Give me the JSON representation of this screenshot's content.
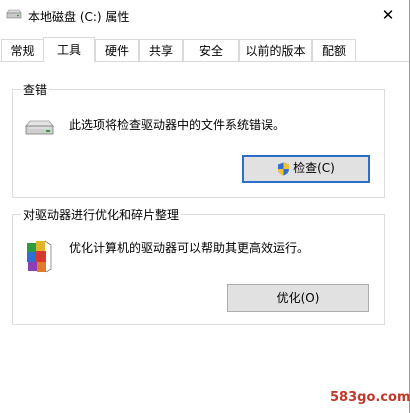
{
  "window": {
    "title": "本地磁盘 (C:) 属性",
    "close_glyph": "✕"
  },
  "tabs": [
    {
      "label": "常规",
      "active": false
    },
    {
      "label": "工具",
      "active": true
    },
    {
      "label": "硬件",
      "active": false
    },
    {
      "label": "共享",
      "active": false
    },
    {
      "label": "安全",
      "active": false
    },
    {
      "label": "以前的版本",
      "active": false
    },
    {
      "label": "配额",
      "active": false
    }
  ],
  "error_check": {
    "group_title": "查错",
    "description": "此选项将检查驱动器中的文件系统错误。",
    "button_label": "检查(C)",
    "icon": "drive-icon",
    "button_icon": "uac-shield-icon"
  },
  "optimize": {
    "group_title": "对驱动器进行优化和碎片整理",
    "description": "优化计算机的驱动器可以帮助其更高效运行。",
    "button_label": "优化(O)",
    "icon": "defrag-icon"
  },
  "watermark": "583go.com",
  "colors": {
    "accent_border": "#2d6ec8",
    "button_bg": "#e1e1e1",
    "group_border": "#dcdcdc",
    "watermark": "#c0392b"
  }
}
